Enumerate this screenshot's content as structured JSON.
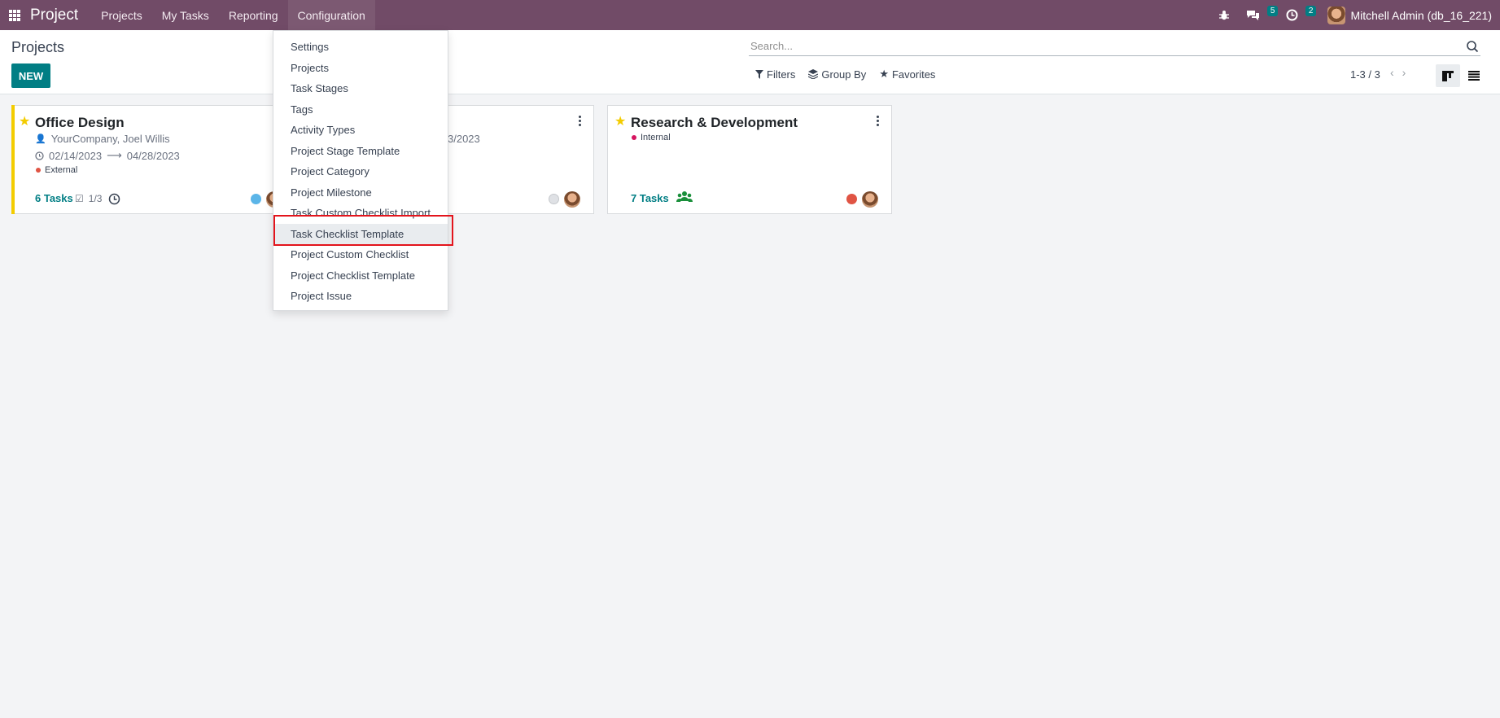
{
  "navbar": {
    "brand": "Project",
    "menus": [
      "Projects",
      "My Tasks",
      "Reporting",
      "Configuration"
    ],
    "messages_count": "5",
    "activities_count": "2",
    "user": "Mitchell Admin (db_16_221)"
  },
  "control": {
    "breadcrumb": "Projects",
    "new_label": "NEW",
    "search_placeholder": "Search...",
    "filters": "Filters",
    "group_by": "Group By",
    "favorites": "Favorites",
    "pager": "1-3 / 3"
  },
  "configuration_menu": {
    "items": [
      "Settings",
      "Projects",
      "Task Stages",
      "Tags",
      "Activity Types",
      "Project Stage Template",
      "Project Category",
      "Project Milestone",
      "Task Custom Checklist Import",
      "Task Checklist Template",
      "Project Custom Checklist",
      "Project Checklist Template",
      "Project Issue"
    ],
    "highlighted": "Task Checklist Template"
  },
  "cards": [
    {
      "title": "Office Design",
      "customer": "YourCompany, Joel Willis",
      "date_start": "02/14/2023",
      "date_end": "04/28/2023",
      "tag": "External",
      "tasks": "6 Tasks",
      "checklist": "1/3",
      "status_color": "#5bb5e8"
    },
    {
      "partial_date": "3/2023",
      "status_color": "#dfe1e5"
    },
    {
      "title": "Research & Development",
      "tag": "Internal",
      "tasks": "7 Tasks",
      "status_color": "#e05444"
    }
  ],
  "colors": {
    "navbar": "#714b67",
    "primary": "#017e84",
    "favorite": "#f3cc00",
    "highlight_box": "#e3141c"
  }
}
